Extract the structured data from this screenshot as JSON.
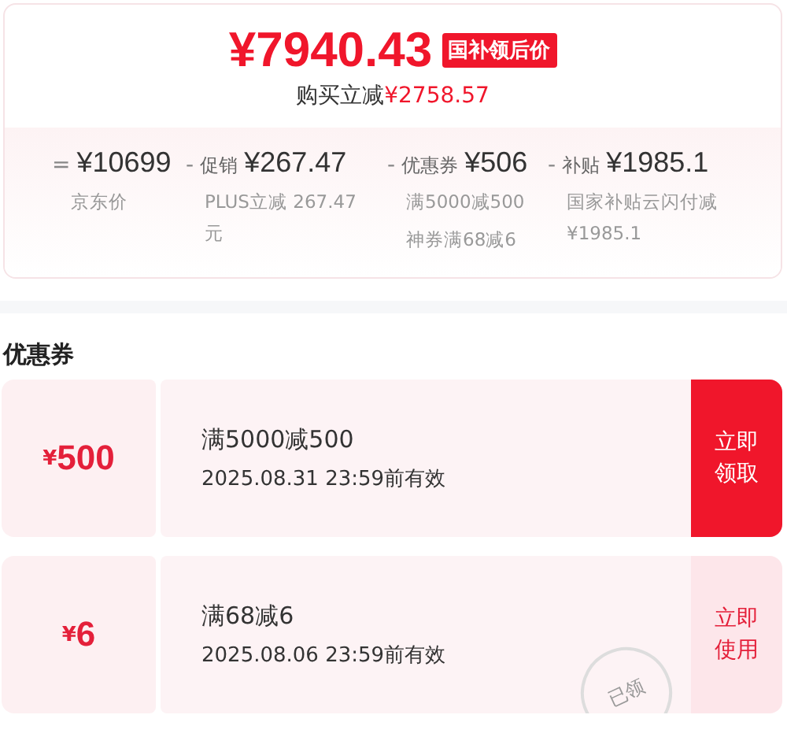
{
  "price": {
    "amount": "¥7940.43",
    "tag": "国补领后价",
    "saving_label": "购买立减",
    "saving_amount": "¥2758.57"
  },
  "breakdown": [
    {
      "operator": "=",
      "amount": "¥10699",
      "notes": [
        "京东价"
      ]
    },
    {
      "operator": "-",
      "label": "促销",
      "amount": "¥267.47",
      "notes": [
        "PLUS立减 267.47元"
      ]
    },
    {
      "operator": "-",
      "label": "优惠券",
      "amount": "¥506",
      "notes": [
        "满5000减500",
        "神券满68减6"
      ]
    },
    {
      "operator": "-",
      "label": "补贴",
      "amount": "¥1985.1",
      "notes": [
        "国家补贴云闪付减¥1985.1"
      ]
    }
  ],
  "coupon_section": {
    "title": "优惠券",
    "coupons": [
      {
        "currency": "¥",
        "value": "500",
        "condition": "满5000减500",
        "validity": "2025.08.31 23:59前有效",
        "claimed": false,
        "action": "立即领取"
      },
      {
        "currency": "¥",
        "value": "6",
        "condition": "满68减6",
        "validity": "2025.08.06 23:59前有效",
        "claimed": true,
        "stamp": "已领",
        "action": "立即使用"
      }
    ]
  }
}
